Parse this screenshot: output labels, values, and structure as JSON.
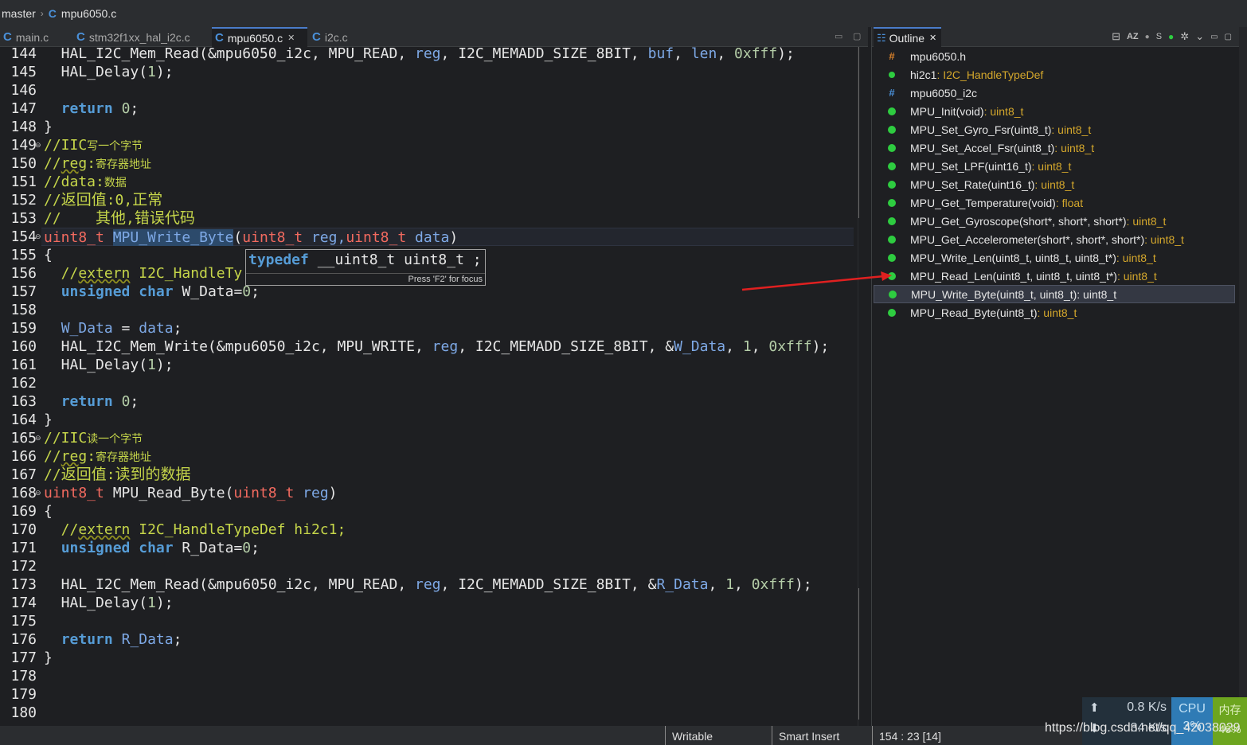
{
  "breadcrumb": {
    "branch": "master",
    "file": "mpu6050.c"
  },
  "editor_tabs": [
    {
      "label": "main.c",
      "active": false
    },
    {
      "label": "stm32f1xx_hal_i2c.c",
      "active": false
    },
    {
      "label": "mpu6050.c",
      "active": true
    },
    {
      "label": "i2c.c",
      "active": false
    }
  ],
  "icons": {
    "c_file": "C",
    "close": "✕",
    "minimize": "▭",
    "maximize": "▢",
    "fold_marker": "⊖"
  },
  "line_numbers": [
    "144",
    "145",
    "146",
    "147",
    "148",
    "149",
    "150",
    "151",
    "152",
    "153",
    "154",
    "155",
    "156",
    "157",
    "158",
    "159",
    "160",
    "161",
    "162",
    "163",
    "164",
    "165",
    "166",
    "167",
    "168",
    "169",
    "170",
    "171",
    "172",
    "173",
    "174",
    "175",
    "176",
    "177",
    "178",
    "179",
    "180"
  ],
  "code": {
    "l144": "  HAL_I2C_Mem_Read(&mpu6050_i2c, MPU_READ, ",
    "l144b": "reg",
    "l144c": ", I2C_MEMADD_SIZE_8BIT, ",
    "l144d": "buf",
    "l144e": ", ",
    "l144f": "len",
    "l144g": ", ",
    "l144h": "0xfff",
    "l144i": ");",
    "l145a": "  HAL_Delay(",
    "l145b": "1",
    "l145c": ");",
    "l147a": "  ",
    "l147b": "return",
    "l147c": " ",
    "l147d": "0",
    "l147e": ";",
    "l148": "}",
    "l149a": "//IIC",
    "l149b": "写一个字节",
    "l150a": "//",
    "l150b": "reg",
    "l150c": ":",
    "l150d": "寄存器地址",
    "l151a": "//data:",
    "l151b": "数据",
    "l152a": "//",
    "l152b": "返回值",
    "l152c": ":0,",
    "l152d": "正常",
    "l153a": "//    ",
    "l153b": "其他",
    "l153c": ",",
    "l153d": "错误代码",
    "l154a": "uint8_t",
    "l154b": " ",
    "l154c": "MPU_Write_Byte",
    "l154d": "(",
    "l154e": "uint8_t",
    "l154f": " reg,",
    "l154g": "uint8_t",
    "l154h": " data",
    "l154i": ")",
    "l155": "{",
    "l156a": "  //",
    "l156b": "extern",
    "l156c": " I2C_HandleTy",
    "l157a": "  ",
    "l157b": "unsigned",
    "l157c": " ",
    "l157d": "char",
    "l157e": " W_Data=",
    "l157f": "0",
    "l157g": ";",
    "l159a": "  ",
    "l159b": "W_Data",
    "l159c": " = ",
    "l159d": "data",
    "l159e": ";",
    "l160a": "  HAL_I2C_Mem_Write(&mpu6050_i2c, MPU_WRITE, ",
    "l160b": "reg",
    "l160c": ", I2C_MEMADD_SIZE_8BIT, &",
    "l160d": "W_Data",
    "l160e": ", ",
    "l160f": "1",
    "l160g": ", ",
    "l160h": "0xfff",
    "l160i": ");",
    "l161a": "  HAL_Delay(",
    "l161b": "1",
    "l161c": ");",
    "l163a": "  ",
    "l163b": "return",
    "l163c": " ",
    "l163d": "0",
    "l163e": ";",
    "l164": "}",
    "l165a": "//IIC",
    "l165b": "读一个字节",
    "l166a": "//",
    "l166b": "reg",
    "l166c": ":",
    "l166d": "寄存器地址",
    "l167a": "//",
    "l167b": "返回值",
    "l167c": ":",
    "l167d": "读到的数据",
    "l168a": "uint8_t",
    "l168b": " MPU_Read_Byte(",
    "l168c": "uint8_t",
    "l168d": " reg",
    "l168e": ")",
    "l169": "{",
    "l170a": "  //",
    "l170b": "extern",
    "l170c": " I2C_HandleTypeDef hi2c1;",
    "l171a": "  ",
    "l171b": "unsigned",
    "l171c": " ",
    "l171d": "char",
    "l171e": " R_Data=",
    "l171f": "0",
    "l171g": ";",
    "l173a": "  HAL_I2C_Mem_Read(&mpu6050_i2c, MPU_READ, ",
    "l173b": "reg",
    "l173c": ", I2C_MEMADD_SIZE_8BIT, &",
    "l173d": "R_Data",
    "l173e": ", ",
    "l173f": "1",
    "l173g": ", ",
    "l173h": "0xfff",
    "l173i": ");",
    "l174a": "  HAL_Delay(",
    "l174b": "1",
    "l174c": ");",
    "l176a": "  ",
    "l176b": "return",
    "l176c": " ",
    "l176d": "R_Data",
    "l176e": ";",
    "l177": "}"
  },
  "tooltip": {
    "a": "typedef",
    "b": " __uint8_t uint8_t ;",
    "footer": "Press 'F2' for focus"
  },
  "outline": {
    "title": "Outline",
    "toolbar": {
      "collapse": "⊟",
      "sort": "AZ",
      "hide_fields": "●",
      "hide_static": "S",
      "hide_nonpublic": "●",
      "settings": "✲",
      "menu": "⌄"
    },
    "items": [
      {
        "name": "mpu6050.h",
        "type": "",
        "icon": "hash-orange"
      },
      {
        "name": "hi2c1",
        "type": " : I2C_HandleTypeDef",
        "icon": "green-dot"
      },
      {
        "name": "mpu6050_i2c",
        "type": "",
        "icon": "hash-blue"
      },
      {
        "name": "MPU_Init(void)",
        "type": " : uint8_t",
        "icon": "green-dot"
      },
      {
        "name": "MPU_Set_Gyro_Fsr(uint8_t)",
        "type": " : uint8_t",
        "icon": "green-dot"
      },
      {
        "name": "MPU_Set_Accel_Fsr(uint8_t)",
        "type": " : uint8_t",
        "icon": "green-dot"
      },
      {
        "name": "MPU_Set_LPF(uint16_t)",
        "type": " : uint8_t",
        "icon": "green-dot"
      },
      {
        "name": "MPU_Set_Rate(uint16_t)",
        "type": " : uint8_t",
        "icon": "green-dot"
      },
      {
        "name": "MPU_Get_Temperature(void)",
        "type": " : float",
        "icon": "green-dot"
      },
      {
        "name": "MPU_Get_Gyroscope(short*, short*, short*)",
        "type": " : uint8_t",
        "icon": "green-dot"
      },
      {
        "name": "MPU_Get_Accelerometer(short*, short*, short*)",
        "type": " : uint8_t",
        "icon": "green-dot"
      },
      {
        "name": "MPU_Write_Len(uint8_t, uint8_t, uint8_t*)",
        "type": " : uint8_t",
        "icon": "green-dot"
      },
      {
        "name": "MPU_Read_Len(uint8_t, uint8_t, uint8_t*)",
        "type": " : uint8_t",
        "icon": "green-dot"
      },
      {
        "name": "MPU_Write_Byte(uint8_t, uint8_t)",
        "type": " : uint8_t",
        "icon": "green-dot",
        "selected": true
      },
      {
        "name": "MPU_Read_Byte(uint8_t)",
        "type": " : uint8_t",
        "icon": "green-dot"
      }
    ]
  },
  "status": {
    "writable": "Writable",
    "insert_mode": "Smart Insert",
    "position": "154 : 23 [14]"
  },
  "network_widget": {
    "up": "0.8 K/s",
    "down": "34 K/s",
    "cpu_label": "CPU",
    "cpu_value": "3%",
    "mem_label": "内存",
    "mem_value": "46%"
  },
  "watermark": "https://blog.csdn.net/qq_42038029",
  "colors": {
    "keyword": "#569cd6",
    "type": "#f26a5f",
    "comment": "#c6d64a",
    "number": "#b5cea8",
    "param": "#7ea9e6",
    "accent": "#4a7cc9",
    "arrow": "#e02020"
  }
}
